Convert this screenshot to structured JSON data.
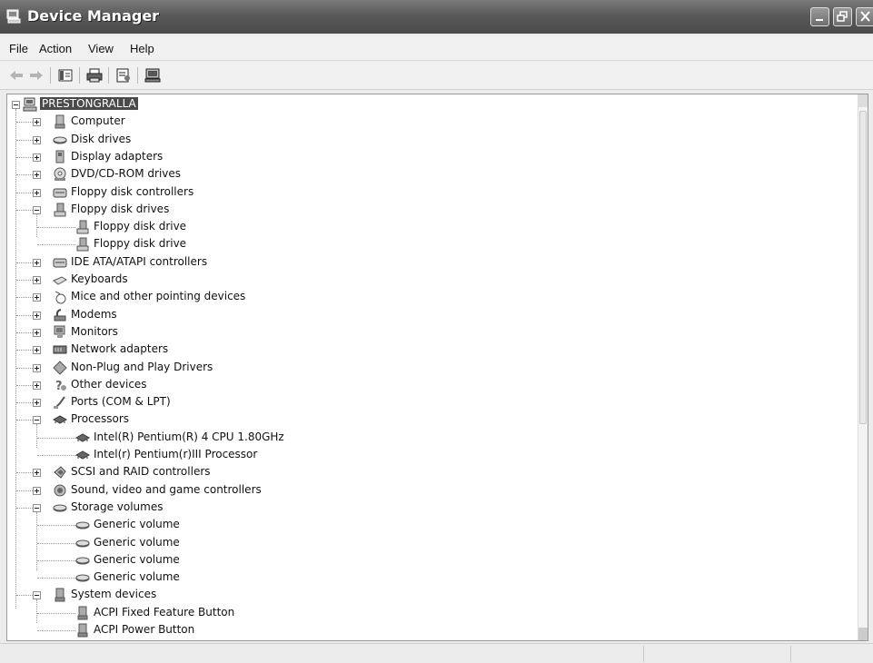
{
  "window": {
    "title": "Device Manager",
    "icon": "computer-icon",
    "controls": [
      "minimize-icon",
      "restore-icon",
      "close-icon"
    ]
  },
  "menubar": {
    "items": [
      "File",
      "Action",
      "View",
      "Help"
    ]
  },
  "toolbar": {
    "buttons": [
      "back-arrow-icon",
      "forward-arrow-icon",
      "show-hide-console-tree-icon",
      "print-icon",
      "properties-icon",
      "scan-hardware-icon"
    ]
  },
  "tree": {
    "root": "PRESTONGRALLA",
    "items": [
      {
        "label": "Computer",
        "icon": "computer-icon",
        "level": 1,
        "state": "collapsed"
      },
      {
        "label": "Disk drives",
        "icon": "disk-drive-icon",
        "level": 1,
        "state": "collapsed"
      },
      {
        "label": "Display adapters",
        "icon": "display-adapter-icon",
        "level": 1,
        "state": "collapsed"
      },
      {
        "label": "DVD/CD-ROM drives",
        "icon": "cd-drive-icon",
        "level": 1,
        "state": "collapsed"
      },
      {
        "label": "Floppy disk controllers",
        "icon": "floppy-controller-icon",
        "level": 1,
        "state": "collapsed"
      },
      {
        "label": "Floppy disk drives",
        "icon": "floppy-drive-icon",
        "level": 1,
        "state": "expanded"
      },
      {
        "label": "Floppy disk drive",
        "icon": "floppy-drive-icon",
        "level": 2
      },
      {
        "label": "Floppy disk drive",
        "icon": "floppy-drive-icon",
        "level": 2
      },
      {
        "label": "IDE ATA/ATAPI controllers",
        "icon": "ide-controller-icon",
        "level": 1,
        "state": "collapsed"
      },
      {
        "label": "Keyboards",
        "icon": "keyboard-icon",
        "level": 1,
        "state": "collapsed"
      },
      {
        "label": "Mice and other pointing devices",
        "icon": "mouse-icon",
        "level": 1,
        "state": "collapsed"
      },
      {
        "label": "Modems",
        "icon": "modem-icon",
        "level": 1,
        "state": "collapsed"
      },
      {
        "label": "Monitors",
        "icon": "monitor-icon",
        "level": 1,
        "state": "collapsed"
      },
      {
        "label": "Network adapters",
        "icon": "network-adapter-icon",
        "level": 1,
        "state": "collapsed"
      },
      {
        "label": "Non-Plug and Play Drivers",
        "icon": "driver-icon",
        "level": 1,
        "state": "collapsed"
      },
      {
        "label": "Other devices",
        "icon": "unknown-device-icon",
        "level": 1,
        "state": "collapsed"
      },
      {
        "label": "Ports (COM & LPT)",
        "icon": "port-icon",
        "level": 1,
        "state": "collapsed"
      },
      {
        "label": "Processors",
        "icon": "processor-icon",
        "level": 1,
        "state": "expanded"
      },
      {
        "label": "Intel(R) Pentium(R) 4 CPU 1.80GHz",
        "icon": "processor-icon",
        "level": 2
      },
      {
        "label": "Intel(r) Pentium(r)III Processor",
        "icon": "processor-icon",
        "level": 2
      },
      {
        "label": "SCSI and RAID controllers",
        "icon": "scsi-controller-icon",
        "level": 1,
        "state": "collapsed"
      },
      {
        "label": "Sound, video and game controllers",
        "icon": "sound-icon",
        "level": 1,
        "state": "collapsed"
      },
      {
        "label": "Storage volumes",
        "icon": "disk-drive-icon",
        "level": 1,
        "state": "expanded"
      },
      {
        "label": "Generic volume",
        "icon": "disk-drive-icon",
        "level": 2
      },
      {
        "label": "Generic volume",
        "icon": "disk-drive-icon",
        "level": 2
      },
      {
        "label": "Generic volume",
        "icon": "disk-drive-icon",
        "level": 2
      },
      {
        "label": "Generic volume",
        "icon": "disk-drive-icon",
        "level": 2
      },
      {
        "label": "System devices",
        "icon": "system-device-icon",
        "level": 1,
        "state": "expanded"
      },
      {
        "label": "ACPI Fixed Feature Button",
        "icon": "system-device-icon",
        "level": 2
      },
      {
        "label": "ACPI Power Button",
        "icon": "system-device-icon",
        "level": 2
      }
    ]
  }
}
